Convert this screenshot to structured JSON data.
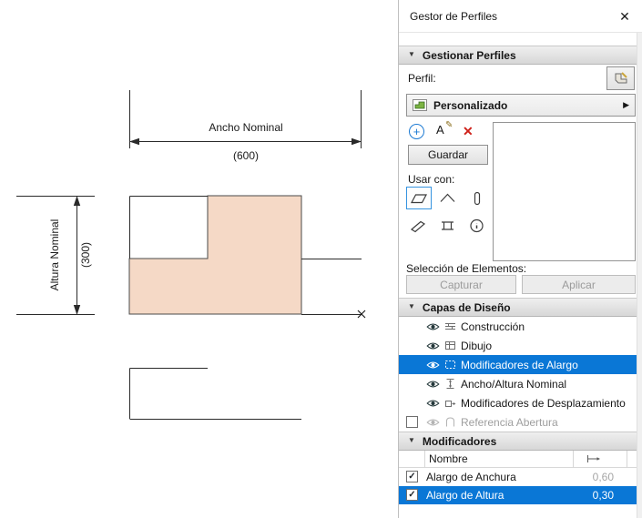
{
  "colors": {
    "selection_blue": "#0a77d6",
    "shape_fill": "#f5d9c6",
    "delete_red": "#cf231c",
    "add_blue": "#1d7ad3"
  },
  "canvas": {
    "width_dim": {
      "label": "Ancho Nominal",
      "value": "(600)"
    },
    "height_dim": {
      "label": "Altura Nominal",
      "value": "(300)"
    }
  },
  "panel": {
    "title": "Gestor de Perfiles",
    "sections": {
      "manage": "Gestionar Perfiles",
      "layers": "Capas de Diseño",
      "modifiers": "Modificadores"
    },
    "profile_label": "Perfil:",
    "profile_selected": "Personalizado",
    "save_label": "Guardar",
    "use_with_label": "Usar con:",
    "selection_label": "Selección de Elementos:",
    "capture_label": "Capturar",
    "apply_label": "Aplicar",
    "layers": [
      {
        "name": "Construcción"
      },
      {
        "name": "Dibujo"
      },
      {
        "name": "Modificadores de Alargo"
      },
      {
        "name": "Ancho/Altura Nominal"
      },
      {
        "name": "Modificadores de Desplazamiento"
      },
      {
        "name": "Referencia Abertura"
      }
    ],
    "modifier_table": {
      "name_header": "Nombre",
      "rows": [
        {
          "name": "Alargo de Anchura",
          "value": "0,60"
        },
        {
          "name": "Alargo de Altura",
          "value": "0,30"
        }
      ]
    }
  },
  "icons": {
    "close": "✕",
    "collapse": "▼",
    "expand_right": "▶",
    "add": "+",
    "rename_letter": "A",
    "rename_pencil": "✎",
    "delete": "✕",
    "check": "✓"
  }
}
